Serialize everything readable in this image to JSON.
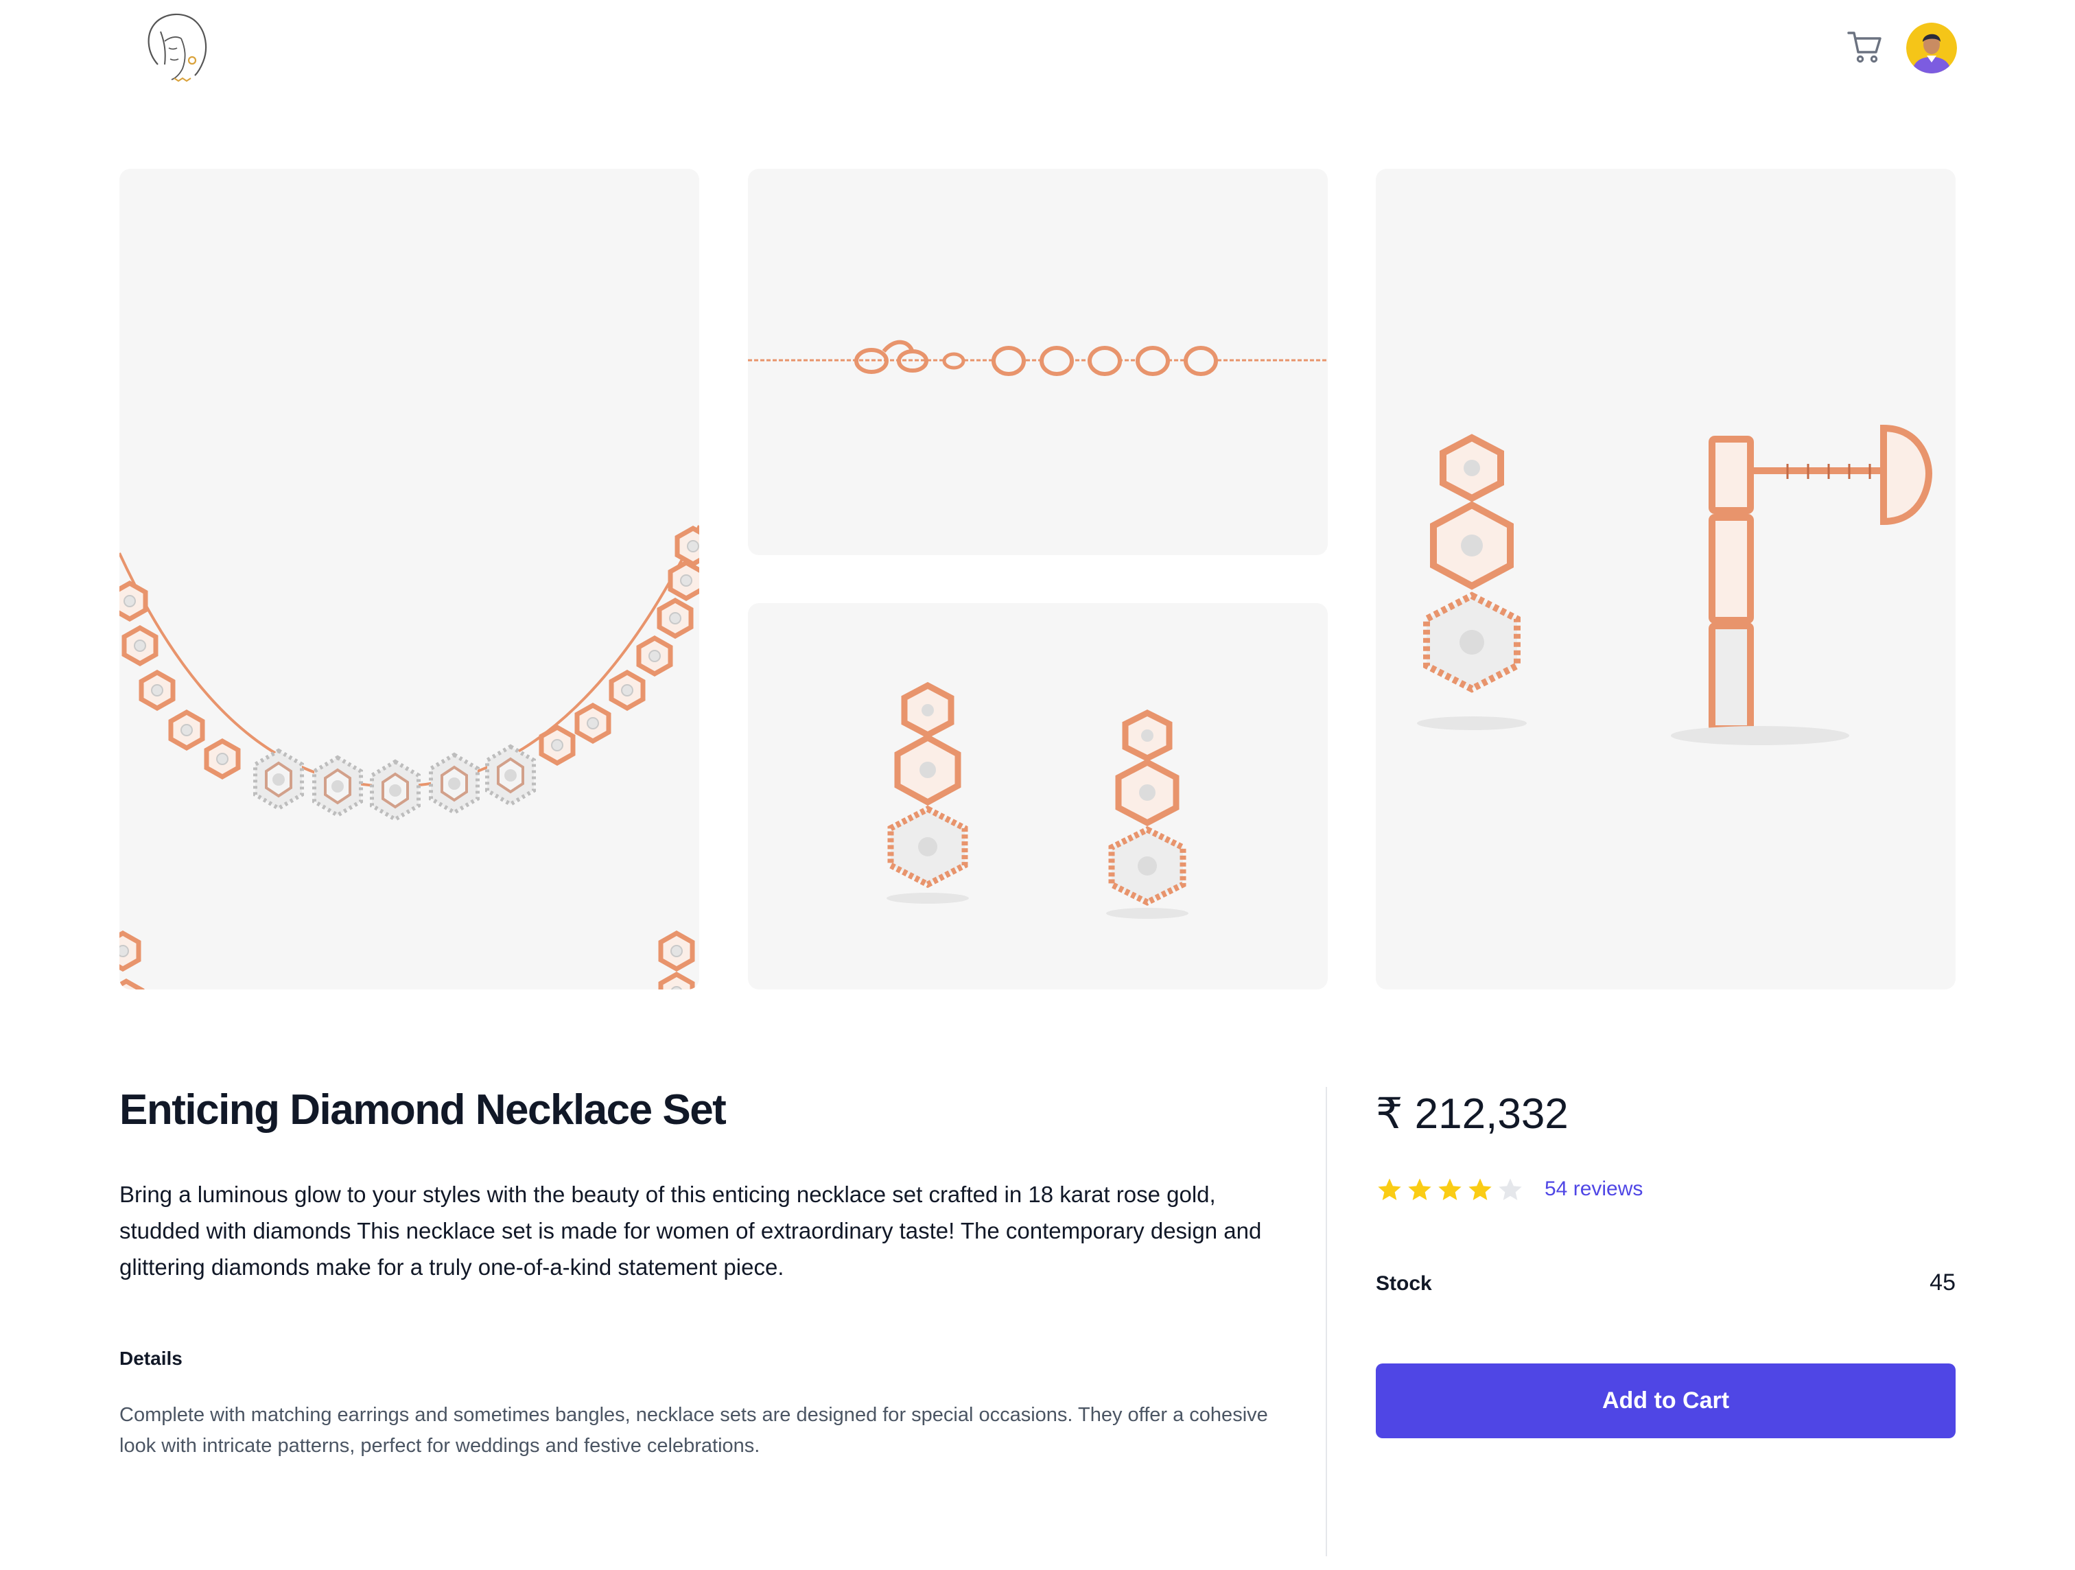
{
  "header": {
    "logo_icon": "woman-face-logo-icon",
    "cart_icon": "shopping-cart-icon",
    "avatar_icon": "user-avatar-icon"
  },
  "gallery": {
    "images": [
      {
        "name": "necklace-image"
      },
      {
        "name": "chain-clasp-image"
      },
      {
        "name": "earrings-front-image"
      },
      {
        "name": "earrings-side-image"
      }
    ]
  },
  "product": {
    "title": "Enticing Diamond Necklace Set",
    "description": "Bring a luminous glow to your styles with the beauty of this enticing necklace set crafted in 18 karat rose gold, studded with diamonds This necklace set is made for women of extraordinary taste! The contemporary design and glittering diamonds make for a truly one-of-a-kind statement piece.",
    "details_heading": "Details",
    "details_text": "Complete with matching earrings and sometimes bangles, necklace sets are designed for special occasions. They offer a cohesive look with intricate patterns, perfect for weddings and festive celebrations."
  },
  "purchase": {
    "price": "₹ 212,332",
    "rating": 4,
    "rating_max": 5,
    "reviews_label": "54 reviews",
    "stock_label": "Stock",
    "stock_value": "45",
    "add_to_cart_label": "Add to Cart"
  },
  "colors": {
    "accent": "#4f46e5",
    "star_filled": "#facc15",
    "star_empty": "#e5e7eb",
    "rose_gold": "#e8946c",
    "tile_background": "#f6f6f6"
  }
}
